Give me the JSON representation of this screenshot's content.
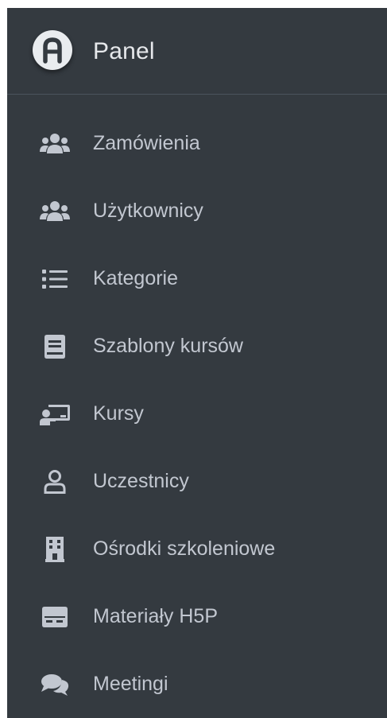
{
  "brand": {
    "title": "Panel",
    "logo_icon": "circle-a-logo-icon"
  },
  "colors": {
    "sidebar_bg": "#343a40",
    "text": "#c2c7d0",
    "logo_bg": "#e9ecef"
  },
  "nav": {
    "items": [
      {
        "label": "Zamówienia",
        "icon": "users-icon"
      },
      {
        "label": "Użytkownicy",
        "icon": "users-icon"
      },
      {
        "label": "Kategorie",
        "icon": "list-icon"
      },
      {
        "label": "Szablony kursów",
        "icon": "book-icon"
      },
      {
        "label": "Kursy",
        "icon": "chalkboard-teacher-icon"
      },
      {
        "label": "Uczestnicy",
        "icon": "user-icon"
      },
      {
        "label": "Ośrodki szkoleniowe",
        "icon": "building-icon"
      },
      {
        "label": "Materiały H5P",
        "icon": "hdd-icon"
      },
      {
        "label": "Meetingi",
        "icon": "comments-icon"
      }
    ]
  }
}
